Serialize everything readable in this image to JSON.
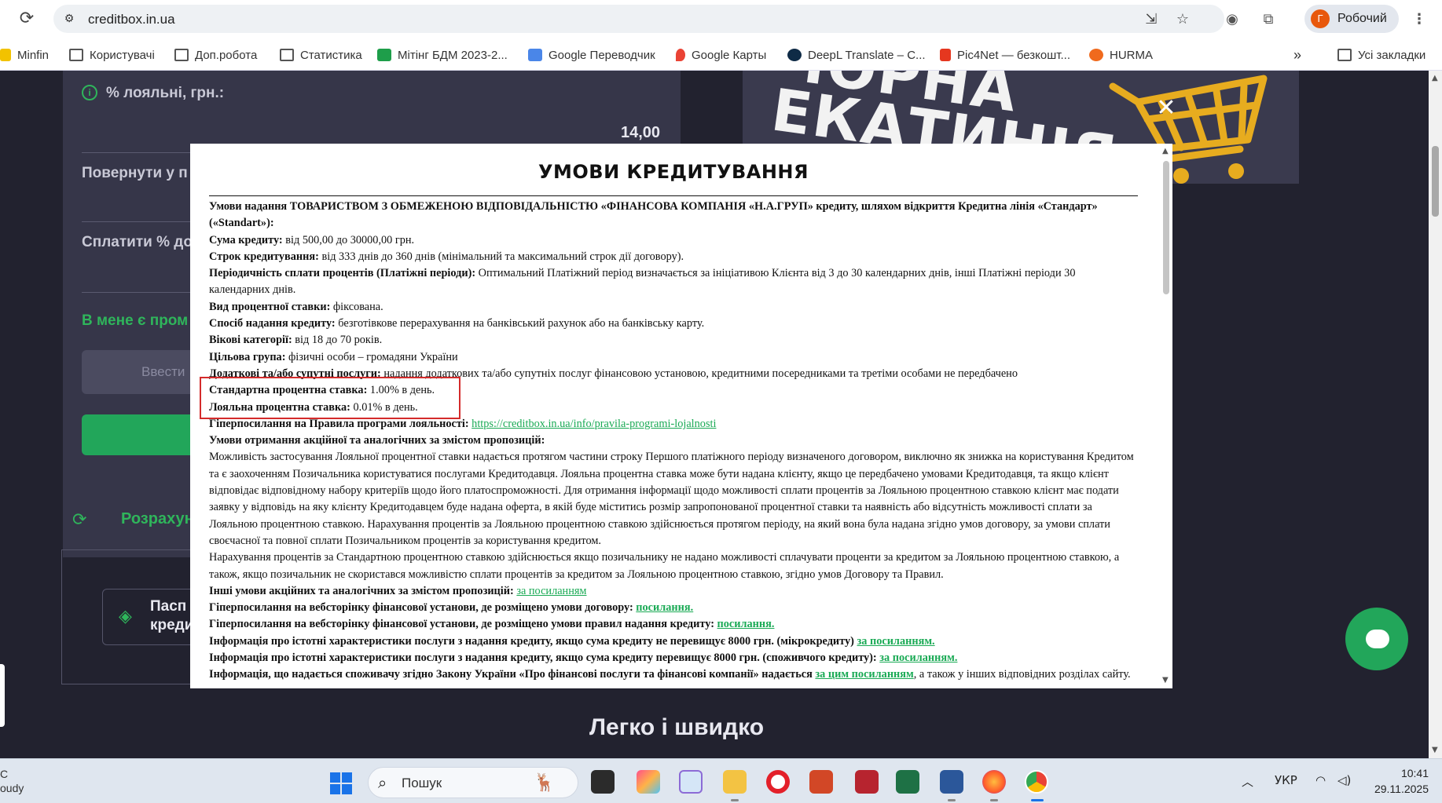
{
  "browser": {
    "url": "creditbox.in.ua",
    "profile_name": "Робочий",
    "profile_initial": "Г",
    "bookmarks": [
      {
        "label": "Minfin",
        "icon": "minfin-icon"
      },
      {
        "label": "Користувачі",
        "icon": "folder-icon"
      },
      {
        "label": "Доп.робота",
        "icon": "folder-icon"
      },
      {
        "label": "Статистика",
        "icon": "folder-icon"
      },
      {
        "label": "Мітінг БДМ 2023-2...",
        "icon": "google-sheets-icon"
      },
      {
        "label": "Google Переводчик",
        "icon": "google-translate-icon"
      },
      {
        "label": "Google Карты",
        "icon": "google-maps-icon"
      },
      {
        "label": "DeepL Translate – С...",
        "icon": "deepl-icon"
      },
      {
        "label": "Pic4Net — безкошт...",
        "icon": "pic4net-icon"
      },
      {
        "label": "HURMA",
        "icon": "hurma-icon"
      }
    ],
    "all_bookmarks_label": "Усі закладки"
  },
  "page": {
    "calc": {
      "loyal_label": "% лояльні, грн.:",
      "loyal_value": "14,00",
      "return_label": "Повернути у п",
      "pay_label": "Сплатити % до",
      "promo_link": "В мене є пром",
      "promo_placeholder": "Ввести",
      "recalc_label": "Розрахун",
      "passport_label_1": "Пасп",
      "passport_label_2": "креди"
    },
    "banner_text_1": "ЧОРНА",
    "banner_text_2": "ЕКАТИНІЯ",
    "bottom_heading": "Легко і швидко"
  },
  "modal": {
    "title": "УМОВИ КРЕДИТУВАННЯ",
    "intro": "Умови надання ТОВАРИСТВОМ З ОБМЕЖЕНОЮ ВІДПОВІДАЛЬНІСТЮ «ФІНАНСОВА КОМПАНІЯ «Н.А.ГРУП» кредиту, шляхом відкриття Кредитна лінія «Стандарт» («Standart»):",
    "amount_label": "Сума кредиту:",
    "amount_value": " від 500,00 до 30000,00 грн.",
    "term_label": "Строк кредитування:",
    "term_value": " від 333 днів до 360 днів (мінімальний та максимальний строк дії договору).",
    "periodicity_label": "Періодичність сплати процентів (Платіжні періоди):",
    "periodicity_value": " Оптимальний Платіжний період визначається за ініціативою Клієнта від 3 до 30 календарних днів, інші Платіжні періоди 30 календарних днів.",
    "rate_type_label": "Вид процентної ставки:",
    "rate_type_value": " фіксована.",
    "method_label": "Спосіб надання кредиту:",
    "method_value": " безготівкове перерахування на банківський рахунок або на банківську карту.",
    "age_label": "Вікові категорії:",
    "age_value": " від 18 до 70 років.",
    "target_label": "Цільова група:",
    "target_value": " фізичні особи – громадяни України",
    "extra_label": "Додаткові та/або супутні послуги:",
    "extra_value": " надання додаткових та/або супутніх послуг фінансовою установою, кредитними посередниками та третіми особами не передбачено",
    "std_rate_label": "Стандартна процентна ставка:",
    "std_rate_value": " 1.00% в день.",
    "loyal_rate_label": "Лояльна процентна ставка:",
    "loyal_rate_value": " 0.01% в день.",
    "loyalty_link_label": "Гіперпосилання на Правила програми лояльності:",
    "loyalty_link_url": "https://creditbox.in.ua/info/pravila-programi-lojalnosti",
    "promo_conditions_label": "Умови отримання акційної та аналогічних за змістом пропозицій:",
    "promo_paragraph_1": "Можливість застосування Лояльної процентної ставки надається протягом частини строку Першого платіжного періоду визначеного договором, виключно як знижка на користування Кредитом та є заохоченням Позичальника користуватися послугами Кредитодавця. Лояльна процентна ставка може бути надана клієнту, якщо це передбачено умовами Кредитодавця, та якщо клієнт відповідає відповідному набору критеріїв щодо його платоспроможності. Для отримання інформації щодо можливості сплати процентів за Лояльною процентною ставкою клієнт має подати заявку у відповідь на яку клієнту Кредитодавцем буде надана оферта, в якій буде міститись розмір запропонованої процентної ставки та наявність або відсутність можливості сплати за Лояльною процентною ставкою. Нарахування процентів за Лояльною процентною ставкою здійснюється протягом періоду, на який вона була надана згідно умов договору, за умови сплати своєчасної та повної сплати Позичальником процентів за користування кредитом.",
    "promo_paragraph_2": "Нарахування процентів за Стандартною процентною ставкою здійснюється якщо позичальнику не надано можливості сплачувати проценти за кредитом за Лояльною процентною ставкою, а також, якщо позичальник не скористався можливістю сплати процентів за кредитом за Лояльною процентною ставкою, згідно умов Договору та Правил.",
    "other_promo_label": "Інші умови акційних та аналогічних за змістом пропозицій:",
    "other_promo_link": "за посиланням",
    "contract_label": "Гіперпосилання на вебсторінку фінансової установи, де розміщено умови договору:",
    "contract_link": "посилання.",
    "rules_label": "Гіперпосилання на вебсторінку фінансової установи, де розміщено умови правил надання кредиту:",
    "rules_link": "посилання.",
    "micro_label": "Інформація про істотні характеристики послуги з надання кредиту, якщо сума кредиту не перевищує 8000 грн. (мікрокредиту)",
    "micro_link": "за посиланням.",
    "consumer_label": "Інформація про істотні характеристики послуги з надання кредиту, якщо сума кредиту перевищує 8000 грн. (споживчого кредиту):",
    "consumer_link": "за посиланням.",
    "law_label": "Інформація, що надається споживачу згідно Закону України «Про фінансові послуги та фінансові компанії» надається",
    "law_link": "за цим посиланням",
    "law_tail": ", а також у інших відповідних розділах сайту."
  },
  "taskbar": {
    "weather_1": "C",
    "weather_2": "oudy",
    "search_placeholder": "Пошук",
    "lang": "УКР",
    "time": "10:41",
    "date": "29.11.2025"
  },
  "colors": {
    "accent_green": "#22a65a",
    "page_bg": "#22222f",
    "highlight_red": "#d42b2b"
  }
}
